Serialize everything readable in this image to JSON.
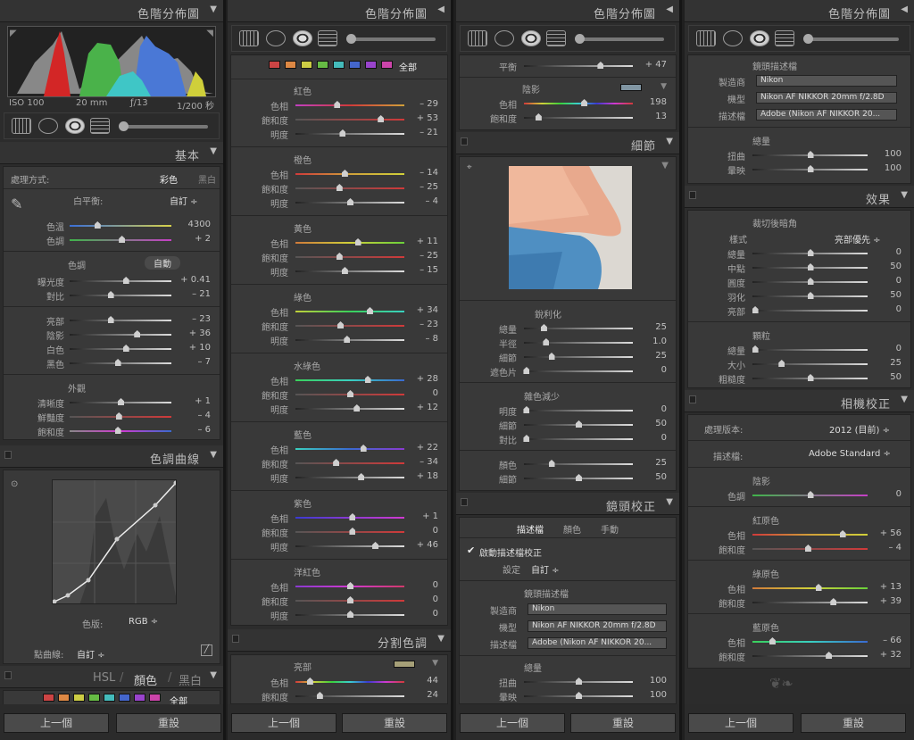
{
  "c1": {
    "histo_title": "色階分佈圖",
    "iso": "ISO 100",
    "focal": "20 mm",
    "aperture": "ƒ/13",
    "shutter": "1/200 秒",
    "basic_title": "基本",
    "treatment_label": "處理方式:",
    "color_opt": "彩色",
    "bw_opt": "黑白",
    "wb_label": "白平衡:",
    "wb_value": "自訂 ÷",
    "temp": {
      "label": "色溫",
      "value": "4300"
    },
    "tint": {
      "label": "色調",
      "value": "+ 2"
    },
    "tone_label": "色調",
    "auto": "自動",
    "exposure": {
      "label": "曝光度",
      "value": "+ 0.41"
    },
    "contrast": {
      "label": "對比",
      "value": "– 21"
    },
    "highlights": {
      "label": "亮部",
      "value": "– 23"
    },
    "shadows": {
      "label": "陰影",
      "value": "+ 36"
    },
    "whites": {
      "label": "白色",
      "value": "+ 10"
    },
    "blacks": {
      "label": "黑色",
      "value": "– 7"
    },
    "presence_label": "外觀",
    "clarity": {
      "label": "清晰度",
      "value": "+ 1"
    },
    "vibrance": {
      "label": "鮮豔度",
      "value": "– 4"
    },
    "saturation": {
      "label": "飽和度",
      "value": "– 6"
    },
    "curve_title": "色調曲線",
    "channel_label": "色版:",
    "channel_value": "RGB ÷",
    "point_label": "點曲線:",
    "point_value": "自訂 ÷",
    "hsl_title": "HSL",
    "hsl_color": "顏色",
    "hsl_bw": "黑白",
    "all": "全部",
    "prev": "上一個",
    "reset": "重設"
  },
  "c2": {
    "title": "色階分佈圖",
    "all": "全部",
    "groups": [
      {
        "name": "紅色",
        "rows": [
          {
            "l": "色相",
            "v": "– 29"
          },
          {
            "l": "飽和度",
            "v": "+ 53"
          },
          {
            "l": "明度",
            "v": "– 21"
          }
        ]
      },
      {
        "name": "橙色",
        "rows": [
          {
            "l": "色相",
            "v": "– 14"
          },
          {
            "l": "飽和度",
            "v": "– 25"
          },
          {
            "l": "明度",
            "v": "– 4"
          }
        ]
      },
      {
        "name": "黃色",
        "rows": [
          {
            "l": "色相",
            "v": "+ 11"
          },
          {
            "l": "飽和度",
            "v": "– 25"
          },
          {
            "l": "明度",
            "v": "– 15"
          }
        ]
      },
      {
        "name": "綠色",
        "rows": [
          {
            "l": "色相",
            "v": "+ 34"
          },
          {
            "l": "飽和度",
            "v": "– 23"
          },
          {
            "l": "明度",
            "v": "– 8"
          }
        ]
      },
      {
        "name": "水綠色",
        "rows": [
          {
            "l": "色相",
            "v": "+ 28"
          },
          {
            "l": "飽和度",
            "v": "0"
          },
          {
            "l": "明度",
            "v": "+ 12"
          }
        ]
      },
      {
        "name": "藍色",
        "rows": [
          {
            "l": "色相",
            "v": "+ 22"
          },
          {
            "l": "飽和度",
            "v": "– 34"
          },
          {
            "l": "明度",
            "v": "+ 18"
          }
        ]
      },
      {
        "name": "紫色",
        "rows": [
          {
            "l": "色相",
            "v": "+ 1"
          },
          {
            "l": "飽和度",
            "v": "0"
          },
          {
            "l": "明度",
            "v": "+ 46"
          }
        ]
      },
      {
        "name": "洋紅色",
        "rows": [
          {
            "l": "色相",
            "v": "0"
          },
          {
            "l": "飽和度",
            "v": "0"
          },
          {
            "l": "明度",
            "v": "0"
          }
        ]
      }
    ],
    "split_title": "分割色調",
    "hl_label": "亮部",
    "hl_hue": {
      "label": "色相",
      "value": "44"
    },
    "hl_sat": {
      "label": "飽和度",
      "value": "24"
    },
    "prev": "上一個",
    "reset": "重設"
  },
  "c3": {
    "title": "色階分佈圖",
    "balance": {
      "label": "平衡",
      "value": "+ 47"
    },
    "shadow_label": "陰影",
    "sh_hue": {
      "label": "色相",
      "value": "198"
    },
    "sh_sat": {
      "label": "飽和度",
      "value": "13"
    },
    "detail_title": "細節",
    "sharpen_label": "銳利化",
    "amount": {
      "label": "總量",
      "value": "25"
    },
    "radius": {
      "label": "半徑",
      "value": "1.0"
    },
    "detail": {
      "label": "細節",
      "value": "25"
    },
    "masking": {
      "label": "遮色片",
      "value": "0"
    },
    "nr_label": "雜色減少",
    "lum": {
      "label": "明度",
      "value": "0"
    },
    "lum_detail": {
      "label": "細節",
      "value": "50"
    },
    "lum_contrast": {
      "label": "對比",
      "value": "0"
    },
    "col": {
      "label": "顏色",
      "value": "25"
    },
    "col_detail": {
      "label": "細節",
      "value": "50"
    },
    "lens_title": "鏡頭校正",
    "tab_profile": "描述檔",
    "tab_color": "顏色",
    "tab_manual": "手動",
    "enable": "啟動描述檔校正",
    "setup_label": "設定",
    "setup_value": "自訂 ÷",
    "profile_label": "鏡頭描述檔",
    "make_label": "製造商",
    "make": "Nikon",
    "model_label": "機型",
    "model": "Nikon AF NIKKOR 20mm f/2.8D",
    "prof_label": "描述檔",
    "prof": "Adobe (Nikon AF NIKKOR 20...",
    "amount_label": "總量",
    "dist": {
      "label": "扭曲",
      "value": "100"
    },
    "vig": {
      "label": "暈映",
      "value": "100"
    },
    "prev": "上一個",
    "reset": "重設"
  },
  "c4": {
    "title": "色階分佈圖",
    "profile_label": "鏡頭描述檔",
    "make_label": "製造商",
    "make": "Nikon",
    "model_label": "機型",
    "model": "Nikon AF NIKKOR 20mm f/2.8D",
    "prof_label": "描述檔",
    "prof": "Adobe (Nikon AF NIKKOR 20...",
    "amount_label": "總量",
    "dist": {
      "label": "扭曲",
      "value": "100"
    },
    "vig": {
      "label": "暈映",
      "value": "100"
    },
    "effects_title": "效果",
    "pcv_label": "裁切後暗角",
    "style_label": "樣式",
    "style_value": "亮部優先 ÷",
    "v_amount": {
      "label": "總量",
      "value": "0"
    },
    "v_mid": {
      "label": "中點",
      "value": "50"
    },
    "v_round": {
      "label": "圓度",
      "value": "0"
    },
    "v_feather": {
      "label": "羽化",
      "value": "50"
    },
    "v_hl": {
      "label": "亮部",
      "value": "0"
    },
    "grain_label": "顆粒",
    "g_amount": {
      "label": "總量",
      "value": "0"
    },
    "g_size": {
      "label": "大小",
      "value": "25"
    },
    "g_rough": {
      "label": "粗糙度",
      "value": "50"
    },
    "cal_title": "相機校正",
    "process_label": "處理版本:",
    "process_value": "2012 (目前) ÷",
    "cprof_label": "描述檔:",
    "cprof_value": "Adobe Standard ÷",
    "cs_label": "陰影",
    "cs_tint": {
      "label": "色調",
      "value": "0"
    },
    "red_label": "紅原色",
    "r_hue": {
      "label": "色相",
      "value": "+ 56"
    },
    "r_sat": {
      "label": "飽和度",
      "value": "– 4"
    },
    "green_label": "綠原色",
    "gr_hue": {
      "label": "色相",
      "value": "+ 13"
    },
    "gr_sat": {
      "label": "飽和度",
      "value": "+ 39"
    },
    "blue_label": "藍原色",
    "b_hue": {
      "label": "色相",
      "value": "– 66"
    },
    "b_sat": {
      "label": "飽和度",
      "value": "+ 32"
    },
    "prev": "上一個",
    "reset": "重設"
  }
}
